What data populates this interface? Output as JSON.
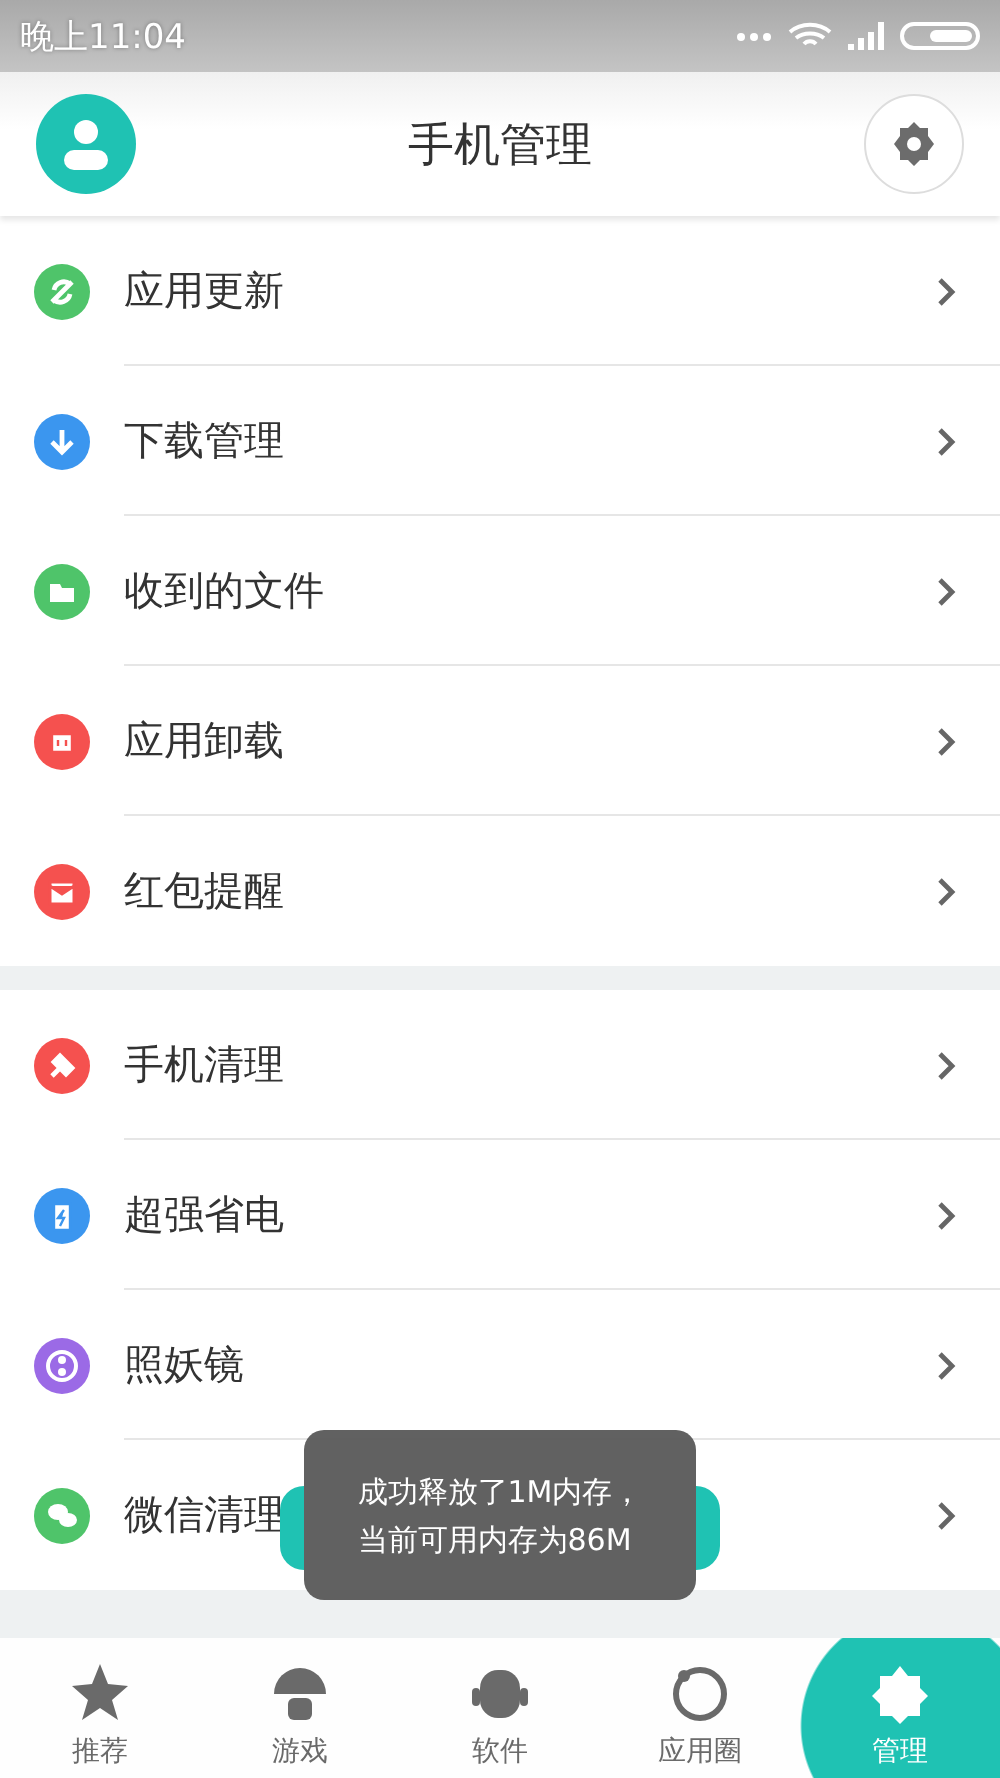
{
  "status_bar": {
    "time": "晚上11:04"
  },
  "header": {
    "title": "手机管理"
  },
  "sections": [
    {
      "items": [
        {
          "label": "应用更新",
          "color": "#4fc46a"
        },
        {
          "label": "下载管理",
          "color": "#3b96ef"
        },
        {
          "label": "收到的文件",
          "color": "#4fc46a"
        },
        {
          "label": "应用卸载",
          "color": "#f5514f"
        },
        {
          "label": "红包提醒",
          "color": "#f5514f"
        }
      ]
    },
    {
      "items": [
        {
          "label": "手机清理",
          "color": "#f5514f"
        },
        {
          "label": "超强省电",
          "color": "#3b96ef"
        },
        {
          "label": "照妖镜",
          "color": "#9b6ae6"
        },
        {
          "label": "微信清理",
          "color": "#4fc46a"
        }
      ]
    }
  ],
  "toast": {
    "lines": [
      "成功释放了1M内存，",
      "当前可用内存为86M"
    ]
  },
  "tabs": [
    {
      "label": "推荐",
      "selected": false
    },
    {
      "label": "游戏",
      "selected": false
    },
    {
      "label": "软件",
      "selected": false
    },
    {
      "label": "应用圈",
      "selected": false
    },
    {
      "label": "管理",
      "selected": true
    }
  ]
}
